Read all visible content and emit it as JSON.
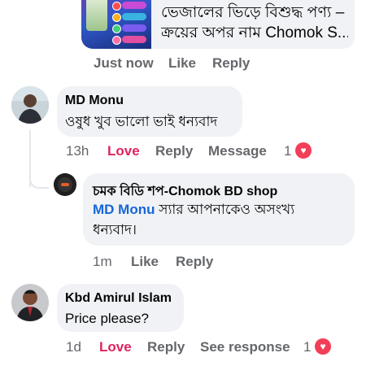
{
  "link_preview": {
    "text_line1": "ভেজালের ভিড়ে বিশুদ্ধ পণ্য –",
    "text_line2": "ক্রয়ের অপর নাম Chomok S..."
  },
  "top_actions": {
    "time": "Just now",
    "like": "Like",
    "reply": "Reply"
  },
  "comments": [
    {
      "name": "MD Monu",
      "text": "ওষুধ খুব ভালো ভাই ধন্যবাদ",
      "time": "13h",
      "reaction_label": "Love",
      "reply": "Reply",
      "extra": "Message",
      "reaction_count": "1",
      "reaction_icon": "heart-icon",
      "reply_thread": {
        "name": "চমক বিডি শপ-Chomok BD shop",
        "mention": "MD Monu",
        "text_line1": " স্যার আপনাকেও অসংখ্য",
        "text_line2": "ধন্যবাদ।",
        "time": "1m",
        "like": "Like",
        "reply": "Reply"
      }
    },
    {
      "name": "Kbd Amirul Islam",
      "text": "Price please?",
      "time": "1d",
      "reaction_label": "Love",
      "reply": "Reply",
      "extra": "See response",
      "reaction_count": "1",
      "reaction_icon": "heart-icon"
    }
  ],
  "colors": {
    "bubble": "#f0f2f5",
    "meta_text": "#65676b",
    "love": "#e0245e",
    "mention": "#1666d9",
    "heart": "#f33e58"
  }
}
